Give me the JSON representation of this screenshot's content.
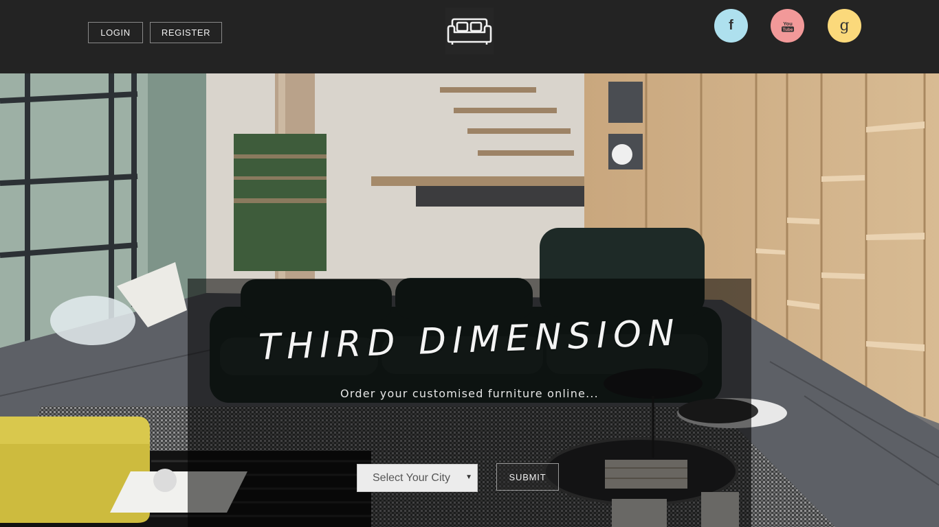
{
  "header": {
    "login_label": "LOGIN",
    "register_label": "REGISTER",
    "logo_icon": "sofa-icon",
    "social": [
      {
        "name": "facebook",
        "icon": "facebook-icon",
        "glyph": "f",
        "color": "#aee0ee"
      },
      {
        "name": "youtube",
        "icon": "youtube-icon",
        "glyph_top": "You",
        "glyph_bottom": "Tube",
        "color": "#f29999"
      },
      {
        "name": "google-plus",
        "icon": "google-plus-icon",
        "glyph": "g",
        "color": "#fbd97b"
      }
    ]
  },
  "hero": {
    "title": "THIRD DIMENSION",
    "subtitle": "Order your customised furniture online...",
    "city_select": {
      "selected": "Select Your City"
    },
    "submit_label": "SUBMIT"
  },
  "colors": {
    "topbar": "#232323",
    "overlay": "rgba(0,0,0,0.55)",
    "select_bg": "#ececec"
  }
}
